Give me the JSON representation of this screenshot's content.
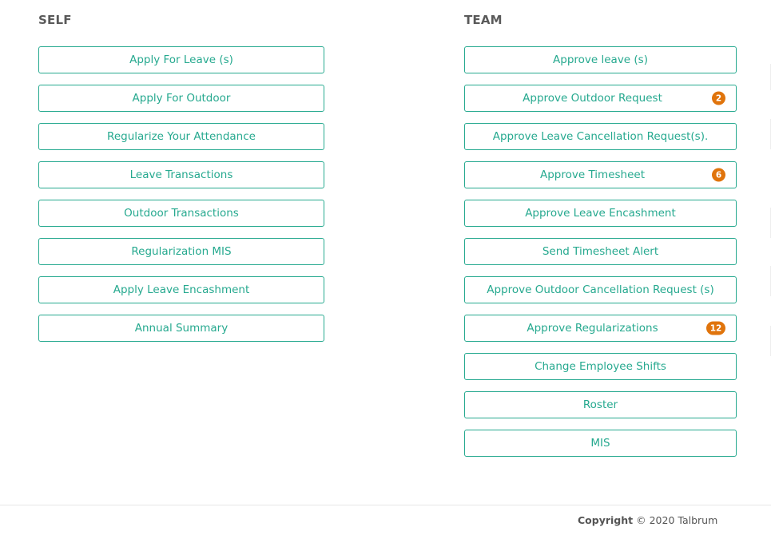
{
  "self": {
    "heading": "SELF",
    "buttons": [
      {
        "label": "Apply For Leave (s)"
      },
      {
        "label": "Apply For Outdoor"
      },
      {
        "label": "Regularize Your Attendance"
      },
      {
        "label": "Leave Transactions"
      },
      {
        "label": "Outdoor Transactions"
      },
      {
        "label": "Regularization MIS"
      },
      {
        "label": "Apply Leave Encashment"
      },
      {
        "label": "Annual Summary"
      }
    ]
  },
  "team": {
    "heading": "TEAM",
    "buttons": [
      {
        "label": "Approve leave (s)",
        "badge": null
      },
      {
        "label": "Approve Outdoor Request",
        "badge": "2"
      },
      {
        "label": "Approve Leave Cancellation Request(s).",
        "badge": null
      },
      {
        "label": "Approve Timesheet",
        "badge": "6"
      },
      {
        "label": "Approve Leave Encashment",
        "badge": null
      },
      {
        "label": "Send Timesheet Alert",
        "badge": null
      },
      {
        "label": "Approve Outdoor Cancellation Request (s)",
        "badge": null
      },
      {
        "label": "Approve Regularizations",
        "badge": "12"
      },
      {
        "label": "Change Employee Shifts",
        "badge": null
      },
      {
        "label": "Roster",
        "badge": null
      },
      {
        "label": "MIS",
        "badge": null
      }
    ]
  },
  "footer": {
    "copyright_label": "Copyright",
    "copyright_text": "© 2020 Talbrum"
  },
  "colors": {
    "accent": "#26a98f",
    "badge": "#e0740c",
    "heading": "#5a5a5a"
  }
}
